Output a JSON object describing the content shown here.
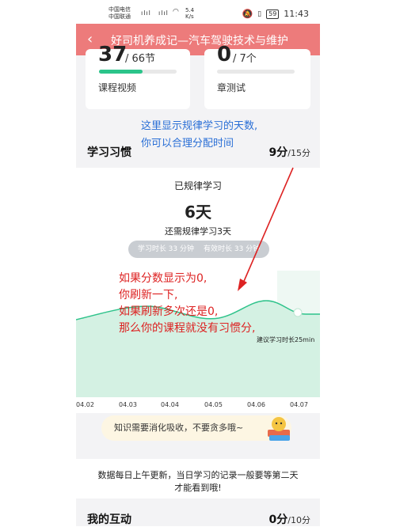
{
  "status_bar": {
    "carrier1": "中国电信",
    "carrier2": "中国联通",
    "speed_value": "5.4",
    "speed_unit": "K/s",
    "battery": "59",
    "time": "11:43"
  },
  "title_bar": {
    "back_glyph": "‹",
    "title": "好司机养成记—汽车驾驶技术与维护"
  },
  "video_card": {
    "count": "37",
    "total": "/ 66节",
    "label": "课程视频",
    "progress": 0.56
  },
  "test_card": {
    "count": "0",
    "total": "/ 7个",
    "label": "章测试",
    "progress": 0
  },
  "annotation_blue": [
    "这里显示规律学习的天数,",
    "你可以合理分配时间"
  ],
  "study_habit": {
    "title": "学习习惯",
    "score": "9分",
    "score_max": "/15分",
    "regular_label": "已规律学习",
    "days": "6天",
    "remaining": "还需规律学习3天",
    "study_time": "学习时长 33 分钟",
    "effective_time": "有效时长 33 分钟"
  },
  "annotation_red": [
    "如果分数显示为0,",
    "你刷新一下,",
    "如果刷新多次还是0,",
    "那么你的课程就没有习惯分,"
  ],
  "chart_data": {
    "type": "area",
    "x": [
      "04.02",
      "04.03",
      "04.04",
      "04.05",
      "04.06",
      "04.07"
    ],
    "reference_label": "建议学习时长25min",
    "colors": {
      "fill": "#d4f1e3",
      "line": "#2fc38b",
      "highlight": "#c6ebd9"
    }
  },
  "tip": {
    "text": "知识需要消化吸收，不要贪多哦~"
  },
  "notice": {
    "line1": "数据每日上午更新，当日学习的记录一般要等第二天",
    "line2": "才能看到哦!"
  },
  "interaction": {
    "title": "我的互动",
    "score": "0分",
    "score_max": "/10分"
  }
}
